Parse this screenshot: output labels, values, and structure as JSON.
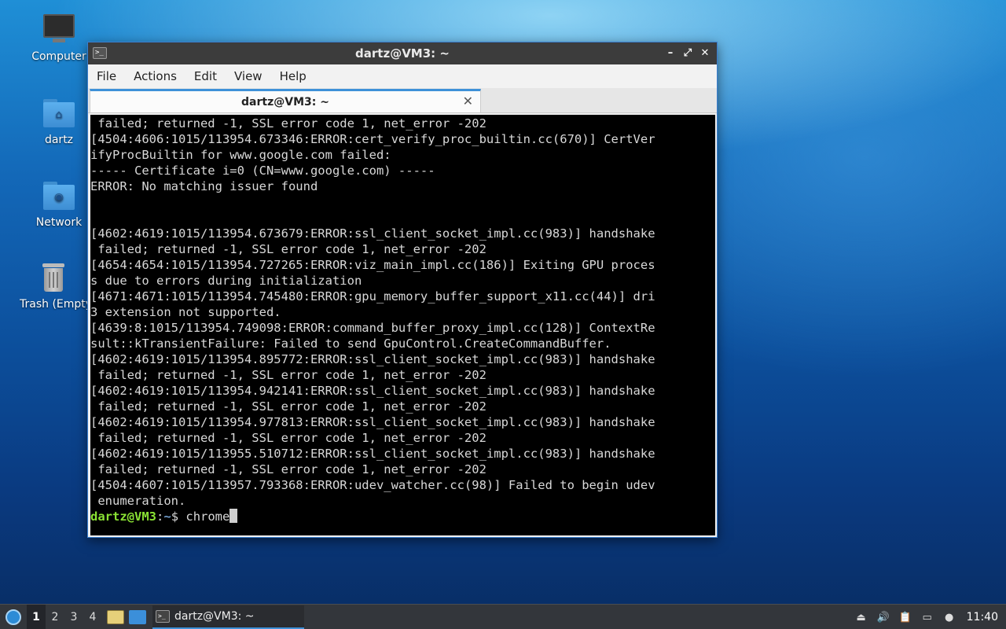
{
  "desktop": {
    "icons": [
      {
        "label": "Computer"
      },
      {
        "label": "dartz"
      },
      {
        "label": "Network"
      },
      {
        "label": "Trash (Empty)"
      }
    ]
  },
  "window": {
    "title": "dartz@VM3: ~",
    "menu": [
      "File",
      "Actions",
      "Edit",
      "View",
      "Help"
    ],
    "tab_label": "dartz@VM3: ~"
  },
  "terminal": {
    "lines": [
      " failed; returned -1, SSL error code 1, net_error -202",
      "[4504:4606:1015/113954.673346:ERROR:cert_verify_proc_builtin.cc(670)] CertVer",
      "ifyProcBuiltin for www.google.com failed:",
      "----- Certificate i=0 (CN=www.google.com) -----",
      "ERROR: No matching issuer found",
      "",
      "",
      "[4602:4619:1015/113954.673679:ERROR:ssl_client_socket_impl.cc(983)] handshake",
      " failed; returned -1, SSL error code 1, net_error -202",
      "[4654:4654:1015/113954.727265:ERROR:viz_main_impl.cc(186)] Exiting GPU proces",
      "s due to errors during initialization",
      "[4671:4671:1015/113954.745480:ERROR:gpu_memory_buffer_support_x11.cc(44)] dri",
      "3 extension not supported.",
      "[4639:8:1015/113954.749098:ERROR:command_buffer_proxy_impl.cc(128)] ContextRe",
      "sult::kTransientFailure: Failed to send GpuControl.CreateCommandBuffer.",
      "[4602:4619:1015/113954.895772:ERROR:ssl_client_socket_impl.cc(983)] handshake",
      " failed; returned -1, SSL error code 1, net_error -202",
      "[4602:4619:1015/113954.942141:ERROR:ssl_client_socket_impl.cc(983)] handshake",
      " failed; returned -1, SSL error code 1, net_error -202",
      "[4602:4619:1015/113954.977813:ERROR:ssl_client_socket_impl.cc(983)] handshake",
      " failed; returned -1, SSL error code 1, net_error -202",
      "[4602:4619:1015/113955.510712:ERROR:ssl_client_socket_impl.cc(983)] handshake",
      " failed; returned -1, SSL error code 1, net_error -202",
      "[4504:4607:1015/113957.793368:ERROR:udev_watcher.cc(98)] Failed to begin udev",
      " enumeration."
    ],
    "prompt": {
      "user_host": "dartz@VM3",
      "sep": ":",
      "path": "~",
      "symbol": "$ ",
      "command": "chrome"
    }
  },
  "taskbar": {
    "workspaces": [
      "1",
      "2",
      "3",
      "4"
    ],
    "active_workspace": "1",
    "task_label": "dartz@VM3: ~",
    "clock": "11:40"
  }
}
